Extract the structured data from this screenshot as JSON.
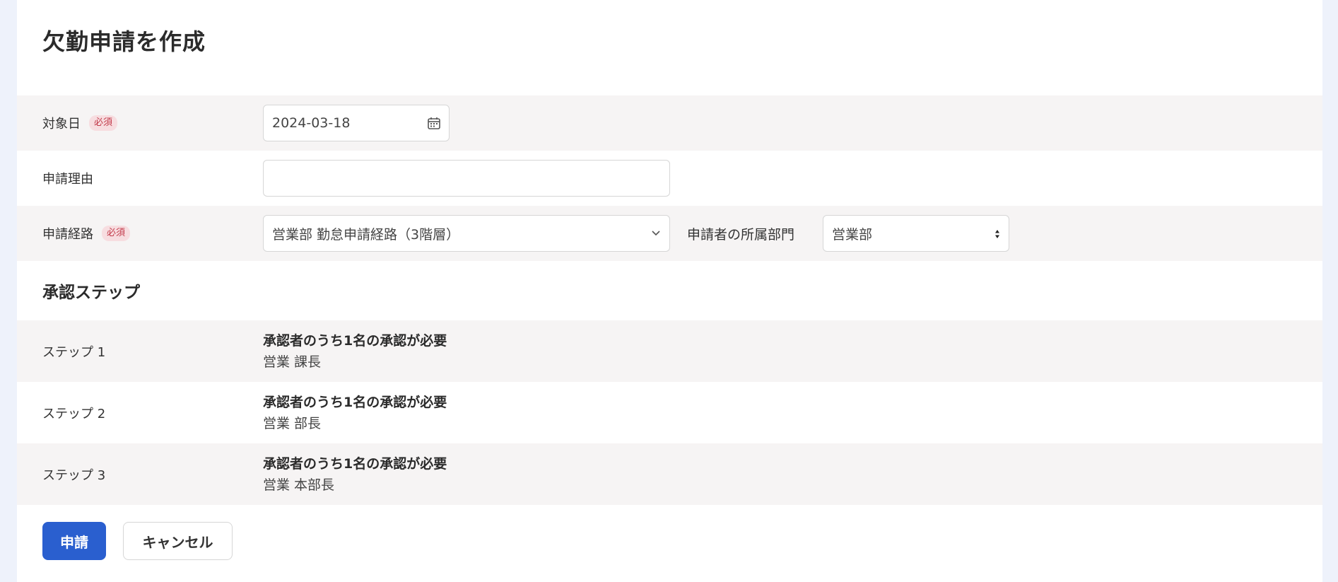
{
  "page": {
    "title": "欠勤申請を作成"
  },
  "form": {
    "target_date": {
      "label": "対象日",
      "required_badge": "必須",
      "value": "2024-03-18"
    },
    "reason": {
      "label": "申請理由",
      "value": ""
    },
    "route": {
      "label": "申請経路",
      "required_badge": "必須",
      "selected": "営業部 勤怠申請経路（3階層）",
      "department_label": "申請者の所属部門",
      "department_selected": "営業部"
    }
  },
  "approval": {
    "heading": "承認ステップ",
    "steps": [
      {
        "label": "ステップ 1",
        "rule": "承認者のうち1名の承認が必要",
        "approver": "営業 課長"
      },
      {
        "label": "ステップ 2",
        "rule": "承認者のうち1名の承認が必要",
        "approver": "営業 部長"
      },
      {
        "label": "ステップ 3",
        "rule": "承認者のうち1名の承認が必要",
        "approver": "営業 本部長"
      }
    ]
  },
  "actions": {
    "submit_label": "申請",
    "cancel_label": "キャンセル"
  },
  "colors": {
    "primary": "#2a5fcf",
    "badge_bg": "#f7dde0",
    "badge_text": "#c23a4a",
    "row_shade": "#f6f4f4",
    "page_bg": "#eef2fb"
  },
  "icons": {
    "date": "calendar-icon",
    "route_select": "chevron-down-icon",
    "department_select": "sort-arrows-icon"
  }
}
